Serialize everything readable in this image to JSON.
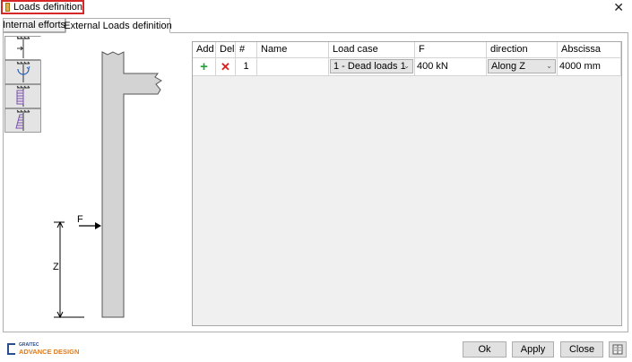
{
  "window": {
    "title": "Loads definition",
    "close_glyph": "✕"
  },
  "tabs": [
    {
      "label": "Internal efforts",
      "active": false
    },
    {
      "label": "External Loads definition",
      "active": true
    }
  ],
  "side_buttons": [
    {
      "icon": "point-load-icon",
      "selected": true
    },
    {
      "icon": "moment-load-icon",
      "selected": false
    },
    {
      "icon": "uniform-load-icon",
      "selected": false
    },
    {
      "icon": "trapezoidal-load-icon",
      "selected": false
    }
  ],
  "diagram": {
    "force_label": "F",
    "distance_label": "Z"
  },
  "table": {
    "columns": [
      "Add",
      "Del",
      "#",
      "Name",
      "Load case",
      "F",
      "direction",
      "Abscissa"
    ],
    "rows": [
      {
        "add": "+",
        "del": "✕",
        "index": "1",
        "name": "",
        "load_case": "1 - Dead loads 1",
        "f": "400 kN",
        "direction": "Along Z",
        "abscissa": "4000 mm"
      }
    ]
  },
  "footer": {
    "logo_top": "GRAITEC",
    "logo_bottom": "ADVANCE DESIGN",
    "ok_label": "Ok",
    "apply_label": "Apply",
    "close_label": "Close"
  },
  "colors": {
    "add": "#22a03a",
    "del": "#d42020",
    "accent_border": "#d62828",
    "logo_blue": "#2a4f8f",
    "logo_orange": "#e07b1a"
  }
}
